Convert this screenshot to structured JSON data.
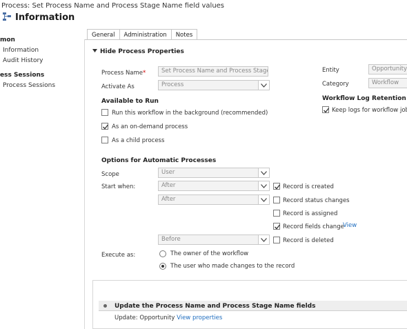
{
  "header": {
    "process_line": "Process: Set Process Name and Process Stage Name field values",
    "title": "Information"
  },
  "nav": {
    "common_group": "mon",
    "information": "Information",
    "audit_history": "Audit History",
    "sessions_group": "ess Sessions",
    "process_sessions": "Process Sessions"
  },
  "tabs": [
    "General",
    "Administration",
    "Notes"
  ],
  "properties": {
    "section_label": "Hide Process Properties",
    "process_name_label": "Process Name",
    "required_mark": "*",
    "process_name_value": "Set Process Name and Process Stage Na",
    "activate_as_label": "Activate As",
    "activate_as_value": "Process",
    "entity_label": "Entity",
    "entity_value": "Opportunity",
    "category_label": "Category",
    "category_value": "Workflow",
    "retention_head": "Workflow Log Retention",
    "keep_logs": "Keep logs for workflow jobs"
  },
  "available": {
    "head": "Available to Run",
    "background": "Run this workflow in the background (recommended)",
    "on_demand": "As an on-demand process",
    "child": "As a child process"
  },
  "options": {
    "head": "Options for Automatic Processes",
    "scope_label": "Scope",
    "scope_value": "User",
    "start_label": "Start when:",
    "after_1": "After",
    "after_2": "After",
    "before": "Before",
    "record_created": "Record is created",
    "status_changes": "Record status changes",
    "assigned": "Record is assigned",
    "fields_change": "Record fields change",
    "view_link": "View",
    "deleted": "Record is deleted",
    "execute_label": "Execute as:",
    "owner": "The owner of the workflow",
    "user_changes": "The user who made changes to the record"
  },
  "steps": {
    "step_title": "Update the Process Name and Process Stage Name fields",
    "update_prefix": "Update:",
    "update_entity": "Opportunity",
    "view_properties": "View properties"
  },
  "colors": {
    "link": "#1f6dbf",
    "border": "#c6c6c6"
  }
}
